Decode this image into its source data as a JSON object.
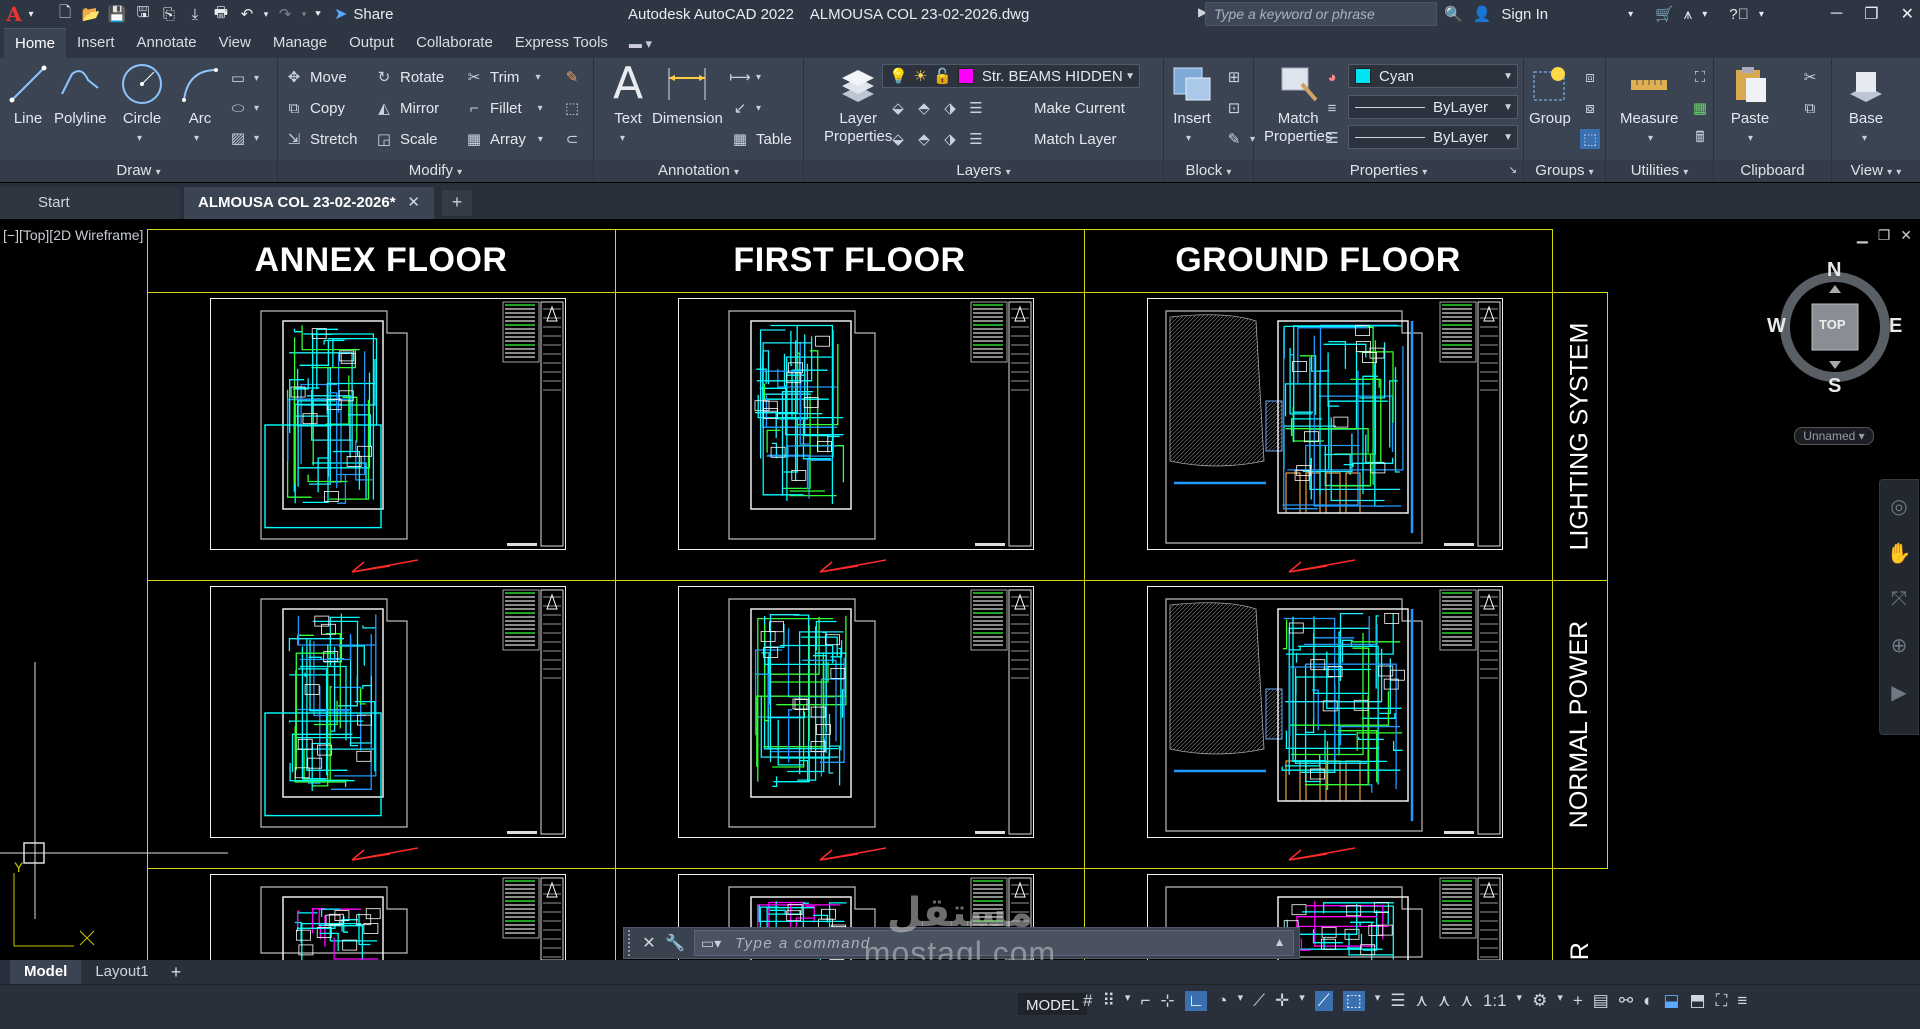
{
  "titlebar": {
    "app_letter": "A",
    "share_label": "Share",
    "title": "Autodesk AutoCAD 2022    ALMOUSA COL 23-02-2026.dwg",
    "search_placeholder": "Type a keyword or phrase",
    "sign_in": "Sign In"
  },
  "ribbon_tabs": [
    "Home",
    "Insert",
    "Annotate",
    "View",
    "Manage",
    "Output",
    "Collaborate",
    "Express Tools"
  ],
  "ribbon": {
    "draw": {
      "title": "Draw",
      "line": "Line",
      "polyline": "Polyline",
      "circle": "Circle",
      "arc": "Arc"
    },
    "modify": {
      "title": "Modify",
      "move": "Move",
      "rotate": "Rotate",
      "trim": "Trim",
      "copy": "Copy",
      "mirror": "Mirror",
      "fillet": "Fillet",
      "stretch": "Stretch",
      "scale": "Scale",
      "array": "Array"
    },
    "annotation": {
      "title": "Annotation",
      "text": "Text",
      "dimension": "Dimension",
      "table": "Table"
    },
    "layers": {
      "title": "Layers",
      "layer_properties_1": "Layer",
      "layer_properties_2": "Properties",
      "current_layer": "Str. BEAMS HIDDEN",
      "current_layer_color": "#ff00ff",
      "make_current": "Make Current",
      "match_layer": "Match Layer"
    },
    "block": {
      "title": "Block",
      "insert": "Insert"
    },
    "properties": {
      "title": "Properties",
      "match_1": "Match",
      "match_2": "Properties",
      "color": "Cyan",
      "color_hex": "#00e5f0",
      "linetype": "ByLayer",
      "lineweight": "ByLayer"
    },
    "groups": {
      "title": "Groups",
      "group": "Group"
    },
    "utilities": {
      "title": "Utilities",
      "measure": "Measure"
    },
    "clipboard": {
      "title": "Clipboard",
      "paste": "Paste"
    },
    "view": {
      "title": "View",
      "base": "Base"
    }
  },
  "doc_tabs": {
    "start": "Start",
    "active": "ALMOUSA COL 23-02-2026*"
  },
  "viewport": {
    "label": "[−][Top][2D Wireframe]"
  },
  "drawing": {
    "columns": [
      "ANNEX FLOOR",
      "FIRST FLOOR",
      "GROUND FLOOR"
    ],
    "rows": [
      "LIGHTING SYSTEM",
      "NORMAL POWER",
      "ER"
    ]
  },
  "viewcube": {
    "n": "N",
    "s": "S",
    "e": "E",
    "w": "W",
    "face": "TOP",
    "ucs_name": "Unnamed"
  },
  "ucs": {
    "y": "Y"
  },
  "command": {
    "placeholder": "Type a command"
  },
  "layout_tabs": {
    "model": "Model",
    "layout1": "Layout1"
  },
  "status": {
    "model": "MODEL",
    "scale": "1:1"
  },
  "watermark": {
    "line1": "مستقل",
    "line2": "mostaql.com"
  }
}
